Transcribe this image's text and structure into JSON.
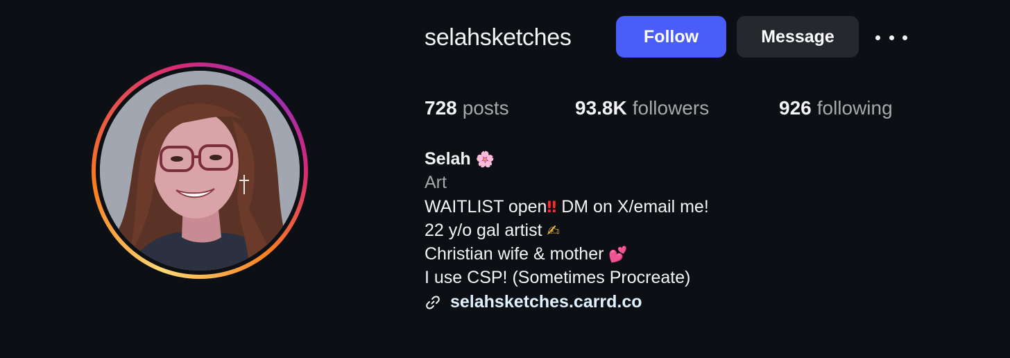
{
  "profile": {
    "username": "selahsketches",
    "full_name": "Selah",
    "full_name_emoji": "🌸",
    "category": "Art",
    "bio_lines": [
      {
        "text": "WAITLIST open",
        "emoji": "‼",
        "after": " DM on X/email me!"
      },
      {
        "text": "22 y/o gal artist ",
        "emoji": "✍",
        "after": ""
      },
      {
        "text": "Christian wife & mother ",
        "emoji": "💕",
        "after": ""
      },
      {
        "text": "I use CSP! (Sometimes Procreate)",
        "emoji": "",
        "after": ""
      }
    ],
    "link": "selahsketches.carrd.co"
  },
  "actions": {
    "follow_label": "Follow",
    "message_label": "Message",
    "more_icon": "ellipsis-icon"
  },
  "stats": {
    "posts": {
      "value": "728",
      "label": "posts"
    },
    "followers": {
      "value": "93.8K",
      "label": "followers"
    },
    "following": {
      "value": "926",
      "label": "following"
    }
  },
  "colors": {
    "background": "#0c0f14",
    "follow_button": "#4a5df9",
    "message_button": "#25292e",
    "muted_text": "#a8a8a8"
  },
  "icons": {
    "link": "link-icon",
    "avatar": "profile-picture"
  }
}
